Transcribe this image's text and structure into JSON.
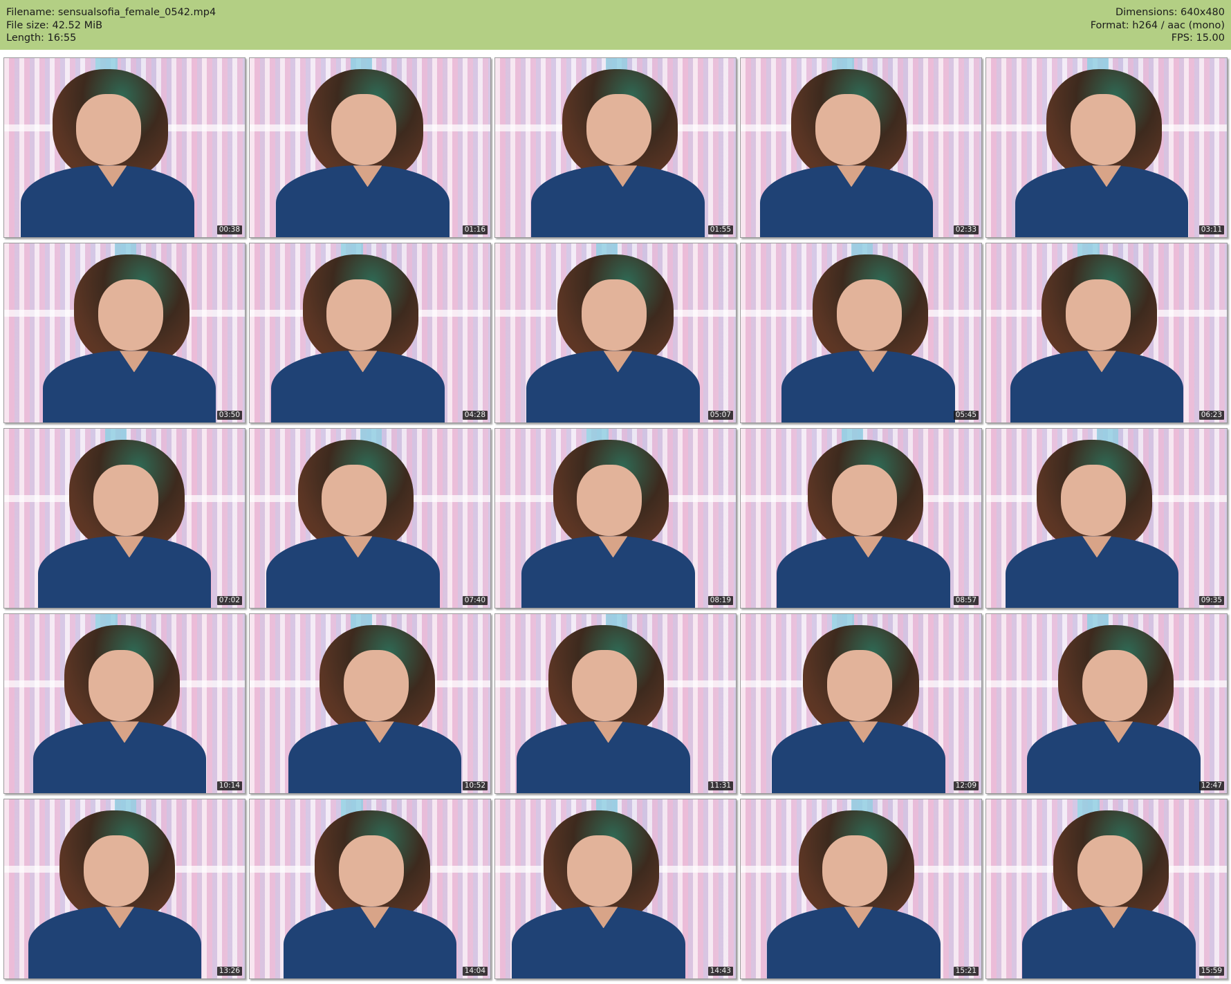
{
  "meta": {
    "filename": "Filename: sensualsofia_female_0542.mp4",
    "filesize": "File size: 42.52 MiB",
    "length": "Length: 16:55",
    "dimensions": "Dimensions: 640x480",
    "format": "Format: h264 / aac (mono)",
    "fps": "FPS: 15.00"
  },
  "colors": {
    "header_bg": "#b3cf84",
    "shirt": "#1f4275",
    "curtain_pink": "#f0c7dd"
  },
  "thumbnails": [
    {
      "time": "00:38"
    },
    {
      "time": "01:16"
    },
    {
      "time": "01:55"
    },
    {
      "time": "02:33"
    },
    {
      "time": "03:11"
    },
    {
      "time": "03:50"
    },
    {
      "time": "04:28"
    },
    {
      "time": "05:07"
    },
    {
      "time": "05:45"
    },
    {
      "time": "06:23"
    },
    {
      "time": "07:02"
    },
    {
      "time": "07:40"
    },
    {
      "time": "08:19"
    },
    {
      "time": "08:57"
    },
    {
      "time": "09:35"
    },
    {
      "time": "10:14"
    },
    {
      "time": "10:52"
    },
    {
      "time": "11:31"
    },
    {
      "time": "12:09"
    },
    {
      "time": "12:47"
    },
    {
      "time": "13:26"
    },
    {
      "time": "14:04"
    },
    {
      "time": "14:43"
    },
    {
      "time": "15:21"
    },
    {
      "time": "15:59"
    }
  ]
}
